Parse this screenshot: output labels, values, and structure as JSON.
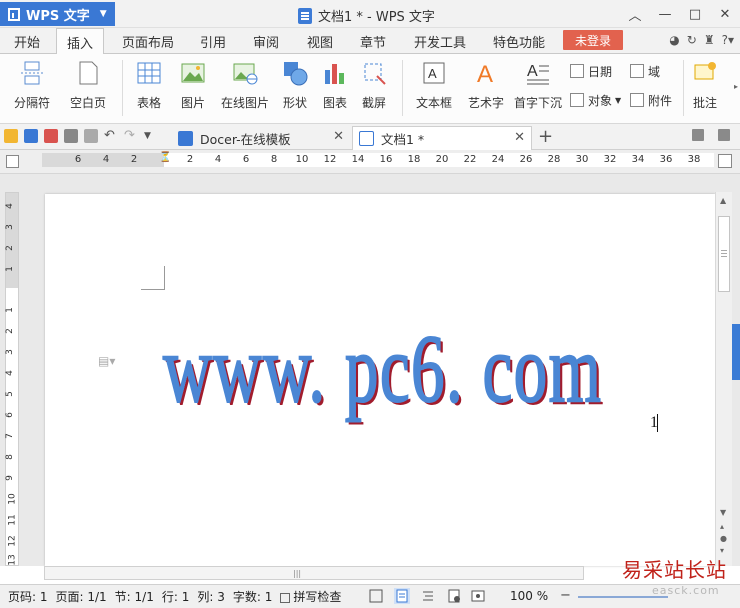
{
  "titlebar": {
    "app_name": "WPS 文字",
    "window_title": "文档1 * - WPS 文字"
  },
  "menu": {
    "tabs": [
      "开始",
      "插入",
      "页面布局",
      "引用",
      "审阅",
      "视图",
      "章节",
      "开发工具",
      "特色功能"
    ],
    "active_tab": "插入",
    "login_label": "未登录"
  },
  "ribbon": {
    "page_break": "分隔符",
    "blank_page": "空白页",
    "table": "表格",
    "picture": "图片",
    "online_picture": "在线图片",
    "shape": "形状",
    "chart": "图表",
    "screenshot": "截屏",
    "text_box": "文本框",
    "wordart": "艺术字",
    "drop_cap": "首字下沉",
    "date": "日期",
    "field": "域",
    "object": "对象",
    "attachment": "附件",
    "comment": "批注"
  },
  "doc_tabs": [
    {
      "label": "Docer-在线模板"
    },
    {
      "label": "文档1 *"
    }
  ],
  "ruler": {
    "h_numbers": [
      "6",
      "4",
      "2",
      "2",
      "4",
      "6",
      "8",
      "10",
      "12",
      "14",
      "16",
      "18",
      "20",
      "22",
      "24",
      "26",
      "28",
      "30",
      "32",
      "34",
      "36",
      "38"
    ],
    "v_numbers": [
      "4",
      "3",
      "2",
      "1",
      "1",
      "2",
      "3",
      "4",
      "5",
      "6",
      "7",
      "8",
      "9",
      "10",
      "11",
      "12",
      "13"
    ]
  },
  "document": {
    "wordart_text": "www. pc6. com",
    "body_text": "1"
  },
  "statusbar": {
    "page_no": "页码: 1",
    "pages": "页面: 1/1",
    "section": "节: 1/1",
    "row": "行: 1",
    "col": "列: 3",
    "word_count": "字数: 1",
    "spell_check": "拼写检查",
    "zoom": "100 %"
  },
  "watermark": {
    "cn": "易采站长站",
    "en": "easck.com"
  },
  "colors": {
    "accent": "#3a78d4",
    "login": "#e2624e",
    "wordart_fill": "#4a86d4",
    "wordart_shadow": "#a11c2d"
  }
}
